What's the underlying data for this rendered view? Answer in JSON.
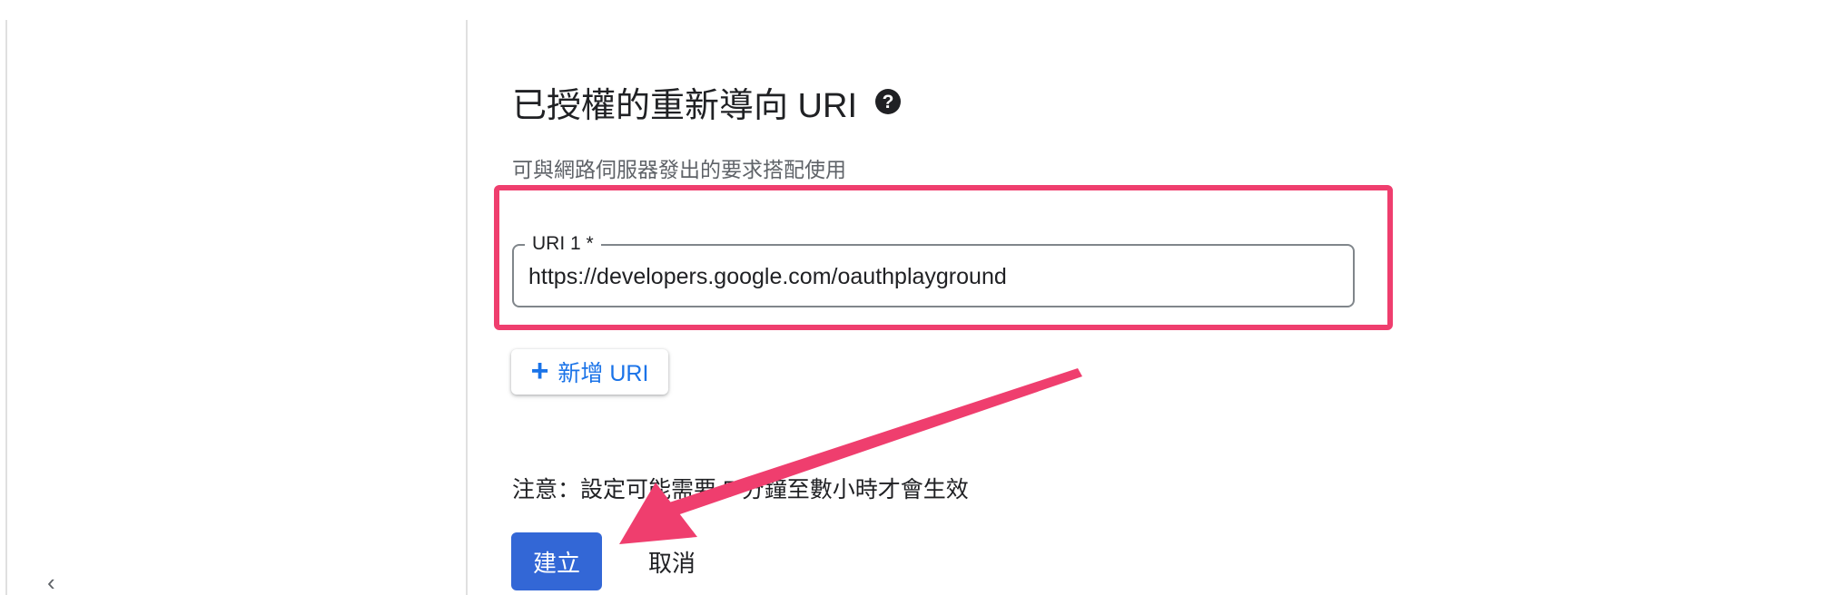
{
  "section": {
    "title": "已授權的重新導向 URI",
    "help_icon": "help-icon",
    "subtitle": "可與網路伺服器發出的要求搭配使用"
  },
  "uri_field": {
    "label": "URI 1 *",
    "value": "https://developers.google.com/oauthplayground"
  },
  "add_uri_button": {
    "icon": "plus-icon",
    "label": "新增 URI"
  },
  "note": "注意：設定可能需要 5 分鐘至數小時才會生效",
  "actions": {
    "create_label": "建立",
    "cancel_label": "取消"
  },
  "sidebar": {
    "collapse_icon": "collapse-icon"
  },
  "colors": {
    "primary": "#3367d6",
    "link_blue": "#1a73e8",
    "annotation_pink": "#ef3e6e",
    "text": "#202124",
    "secondary_text": "#5f6368"
  }
}
